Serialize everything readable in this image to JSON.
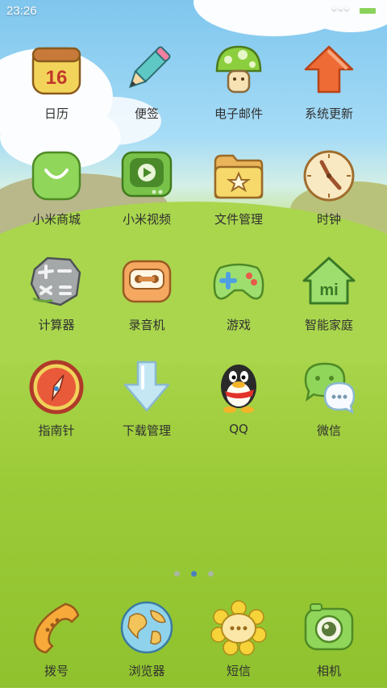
{
  "status_bar": {
    "time": "23:26",
    "battery_level": 0.82,
    "icons": [
      "signal-dots-icon",
      "charging-bolt-icon",
      "battery-icon"
    ]
  },
  "apps": [
    {
      "label": "日历",
      "icon": "calendar-icon",
      "icon_text": "16"
    },
    {
      "label": "便签",
      "icon": "pencil-icon"
    },
    {
      "label": "电子邮件",
      "icon": "mushroom-icon"
    },
    {
      "label": "系统更新",
      "icon": "up-arrow-icon"
    },
    {
      "label": "小米商城",
      "icon": "shopping-bag-icon"
    },
    {
      "label": "小米视频",
      "icon": "tv-play-icon"
    },
    {
      "label": "文件管理",
      "icon": "folder-star-icon"
    },
    {
      "label": "时钟",
      "icon": "clock-icon"
    },
    {
      "label": "计算器",
      "icon": "stone-calculator-icon"
    },
    {
      "label": "录音机",
      "icon": "cassette-icon"
    },
    {
      "label": "游戏",
      "icon": "gamepad-icon"
    },
    {
      "label": "智能家庭",
      "icon": "smart-home-icon",
      "icon_text": "mi"
    },
    {
      "label": "指南针",
      "icon": "compass-icon"
    },
    {
      "label": "下载管理",
      "icon": "download-arrow-icon"
    },
    {
      "label": "QQ",
      "icon": "qq-penguin-icon"
    },
    {
      "label": "微信",
      "icon": "wechat-bubbles-icon"
    }
  ],
  "pager": {
    "pages": 3,
    "active": 2
  },
  "dock": [
    {
      "label": "拨号",
      "icon": "phone-icon"
    },
    {
      "label": "浏览器",
      "icon": "globe-icon"
    },
    {
      "label": "短信",
      "icon": "sunflower-message-icon"
    },
    {
      "label": "相机",
      "icon": "camera-icon"
    }
  ],
  "colors": {
    "label_text": "#303030",
    "pager_active": "#4a7fc1",
    "pager_inactive": "#a9b8a0",
    "battery_fill": "#8ad25c"
  }
}
